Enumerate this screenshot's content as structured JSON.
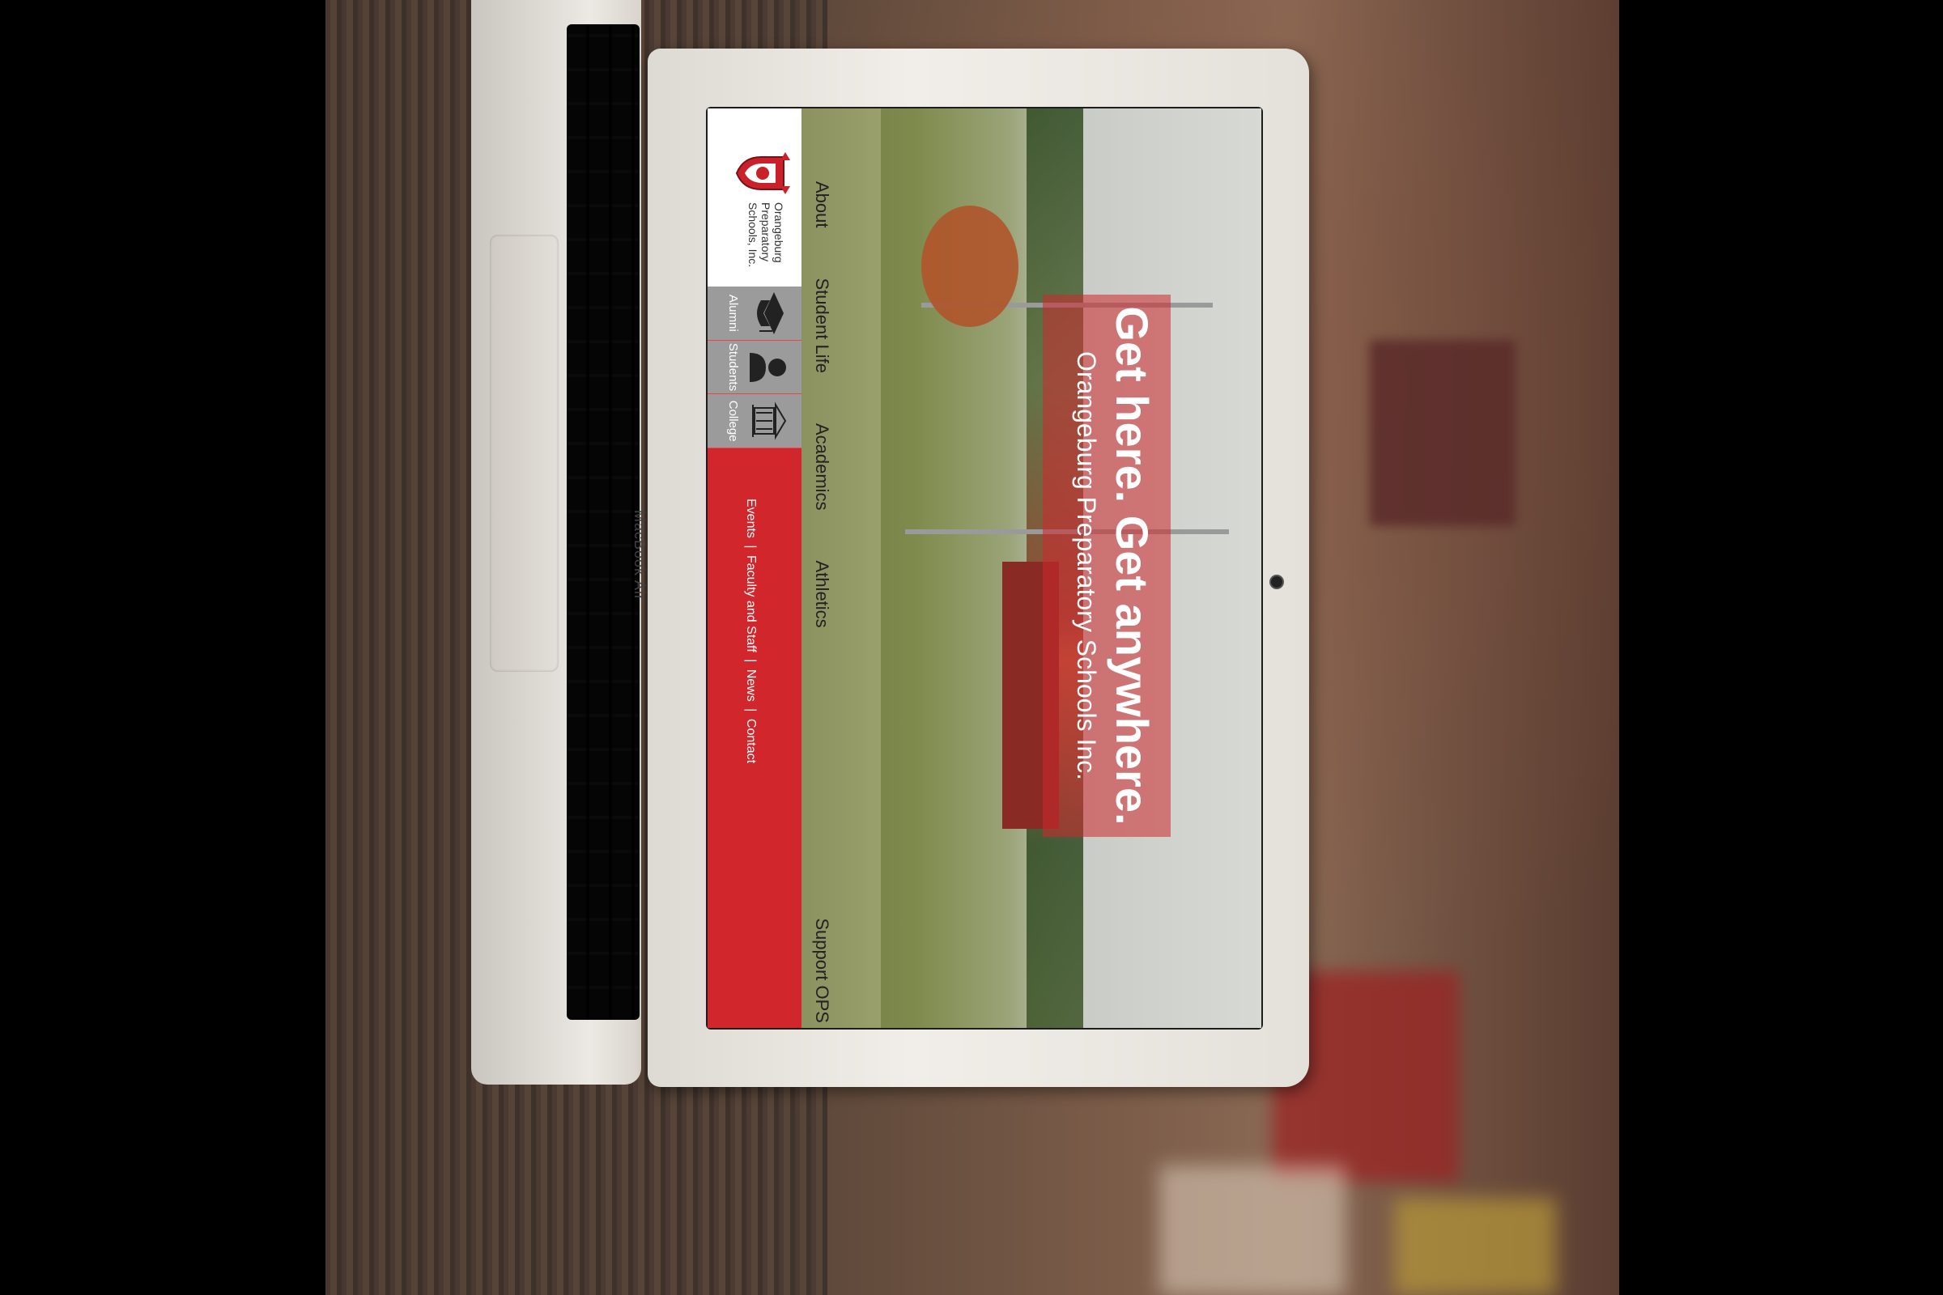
{
  "device": {
    "brand": "MacBook Air"
  },
  "site": {
    "logo_lines": [
      "Orangeburg",
      "Preparatory",
      "Schools, Inc."
    ],
    "quick_links": [
      {
        "label": "Alumni",
        "icon": "graduation-cap-icon"
      },
      {
        "label": "Students",
        "icon": "student-icon"
      },
      {
        "label": "College",
        "icon": "college-building-icon"
      }
    ],
    "utility": [
      "Events",
      "|",
      "Faculty and Staff",
      "|",
      "News",
      "|",
      "Contact"
    ],
    "main_nav": [
      "About",
      "Student Life",
      "Academics",
      "Athletics"
    ],
    "support_label": "Support OPS",
    "hero": {
      "title": "Get here. Get anywhere.",
      "subtitle": "Orangeburg Preparatory Schools Inc."
    },
    "colors": {
      "accent": "#d1262c",
      "quick_bg": "#9b9b9b"
    }
  }
}
